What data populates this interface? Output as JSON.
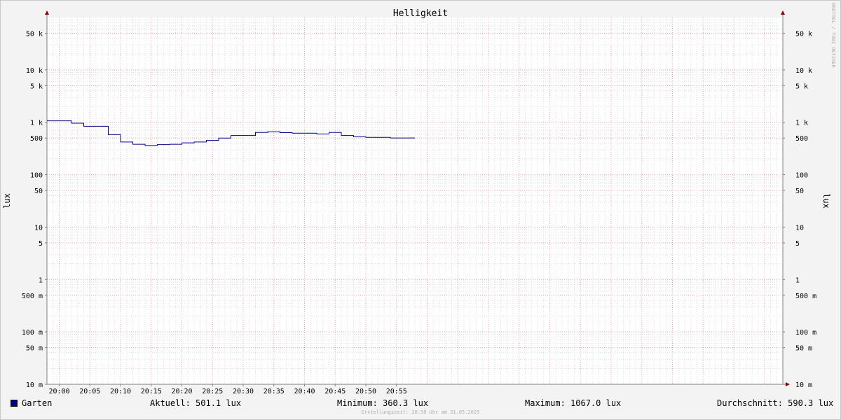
{
  "chart_data": {
    "type": "line",
    "title": "Helligkeit",
    "ylabel": "lux",
    "yscale": "log",
    "ylim": [
      0.01,
      100000
    ],
    "x_range": [
      "19:58",
      "21:58"
    ],
    "x_ticks": [
      "20:00",
      "20:05",
      "20:10",
      "20:15",
      "20:20",
      "20:25",
      "20:30",
      "20:35",
      "20:40",
      "20:45",
      "20:50",
      "20:55"
    ],
    "y_ticks": [
      {
        "value": 0.01,
        "label": "10 m"
      },
      {
        "value": 0.05,
        "label": "50 m"
      },
      {
        "value": 0.1,
        "label": "100 m"
      },
      {
        "value": 0.5,
        "label": "500 m"
      },
      {
        "value": 1,
        "label": "1"
      },
      {
        "value": 5,
        "label": "5"
      },
      {
        "value": 10,
        "label": "10"
      },
      {
        "value": 50,
        "label": "50"
      },
      {
        "value": 100,
        "label": "100"
      },
      {
        "value": 500,
        "label": "500"
      },
      {
        "value": 1000,
        "label": "1 k"
      },
      {
        "value": 5000,
        "label": "5 k"
      },
      {
        "value": 10000,
        "label": "10 k"
      },
      {
        "value": 50000,
        "label": "50 k"
      }
    ],
    "grid": true,
    "series": [
      {
        "name": "Garten",
        "color": "#00008b",
        "steps": [
          {
            "x": "19:58",
            "y": 1067
          },
          {
            "x": "20:02",
            "y": 960
          },
          {
            "x": "20:04",
            "y": 840
          },
          {
            "x": "20:08",
            "y": 580
          },
          {
            "x": "20:10",
            "y": 420
          },
          {
            "x": "20:12",
            "y": 380
          },
          {
            "x": "20:14",
            "y": 360
          },
          {
            "x": "20:16",
            "y": 375
          },
          {
            "x": "20:18",
            "y": 380
          },
          {
            "x": "20:20",
            "y": 405
          },
          {
            "x": "20:22",
            "y": 420
          },
          {
            "x": "20:24",
            "y": 450
          },
          {
            "x": "20:26",
            "y": 500
          },
          {
            "x": "20:28",
            "y": 560
          },
          {
            "x": "20:30",
            "y": 560
          },
          {
            "x": "20:32",
            "y": 640
          },
          {
            "x": "20:34",
            "y": 660
          },
          {
            "x": "20:36",
            "y": 635
          },
          {
            "x": "20:38",
            "y": 620
          },
          {
            "x": "20:42",
            "y": 600
          },
          {
            "x": "20:44",
            "y": 640
          },
          {
            "x": "20:46",
            "y": 560
          },
          {
            "x": "20:48",
            "y": 530
          },
          {
            "x": "20:50",
            "y": 515
          },
          {
            "x": "20:54",
            "y": 501
          },
          {
            "x": "20:58",
            "y": 501
          }
        ]
      }
    ],
    "legend": "bottom-left"
  },
  "stats": {
    "current": "Aktuell: 501.1 lux",
    "minimum": "Minimum: 360.3 lux",
    "maximum": "Maximum: 1067.0 lux",
    "average": "Durchschnitt: 590.3 lux"
  },
  "watermark": "RRDTOOL / TOBI OETIKER",
  "created": "Erstellungszeit: 20:58 Uhr am 31.05.2025"
}
